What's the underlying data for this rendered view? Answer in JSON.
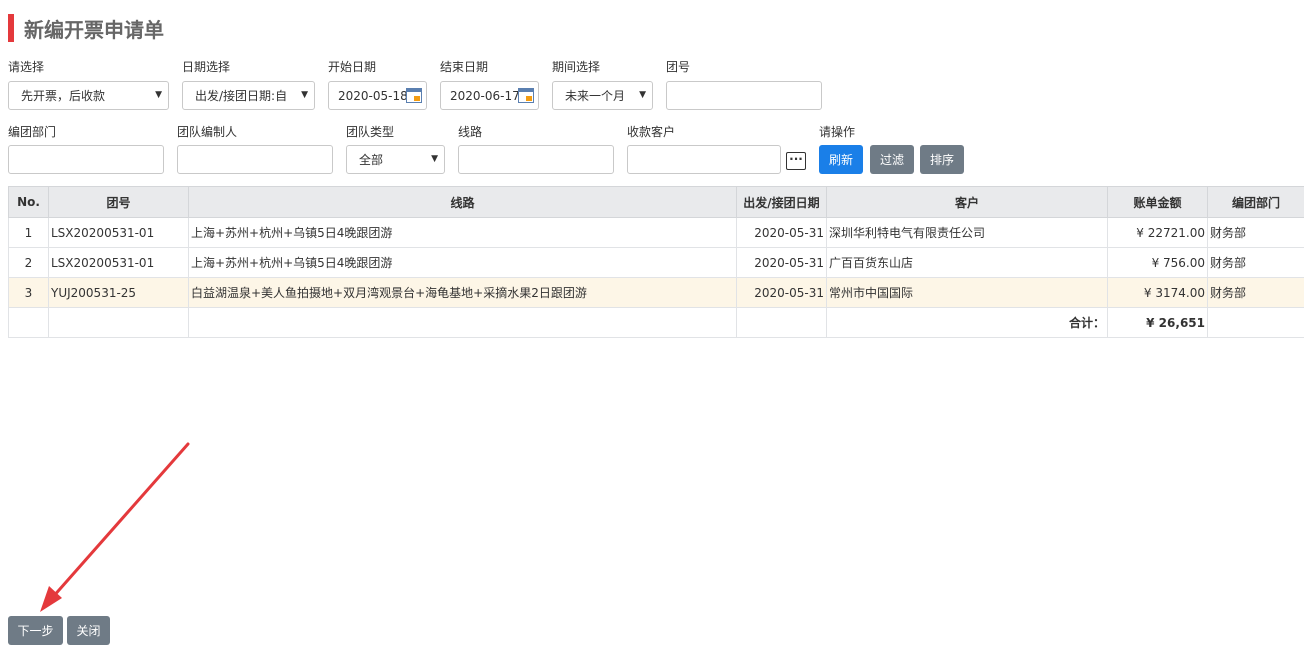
{
  "page": {
    "title": "新编开票申请单"
  },
  "filters": {
    "select_label": "请选择",
    "select_value": "先开票，后收款",
    "date_select_label": "日期选择",
    "date_select_value": "出发/接团日期:自",
    "start_date_label": "开始日期",
    "start_date_value": "2020-05-18",
    "end_date_label": "结束日期",
    "end_date_value": "2020-06-17",
    "period_label": "期间选择",
    "period_value": "未来一个月",
    "group_no_label": "团号",
    "group_no_value": "",
    "dept_label": "编团部门",
    "dept_value": "",
    "maker_label": "团队编制人",
    "maker_value": "",
    "type_label": "团队类型",
    "type_value": "全部",
    "route_label": "线路",
    "route_value": "",
    "customer_label": "收款客户",
    "customer_value": "",
    "more_icon": "ellipsis-icon",
    "ops_label": "请操作",
    "refresh": "刷新",
    "filter": "过滤",
    "sort": "排序"
  },
  "table": {
    "headers": [
      "No.",
      "团号",
      "线路",
      "出发/接团日期",
      "客户",
      "账单金额",
      "编团部门"
    ],
    "rows": [
      {
        "no": "1",
        "group": "LSX20200531-01",
        "route": "上海+苏州+杭州+乌镇5日4晚跟团游",
        "date": "2020-05-31",
        "customer": "深圳华利特电气有限责任公司",
        "amount": "¥ 22721.00",
        "dept": "财务部"
      },
      {
        "no": "2",
        "group": "LSX20200531-01",
        "route": "上海+苏州+杭州+乌镇5日4晚跟团游",
        "date": "2020-05-31",
        "customer": "广百百货东山店",
        "amount": "¥ 756.00",
        "dept": "财务部"
      },
      {
        "no": "3",
        "group": "YUJ200531-25",
        "route": "白益湖温泉+美人鱼拍摄地+双月湾观景台+海龟基地+采摘水果2日跟团游",
        "date": "2020-05-31",
        "customer": "常州市中国国际",
        "amount": "¥ 3174.00",
        "dept": "财务部"
      }
    ],
    "total_label": "合计：",
    "total_value": "¥ 26,651"
  },
  "footer": {
    "next": "下一步",
    "close": "关闭"
  },
  "colors": {
    "accent": "#e4393c",
    "primary": "#1a7fe8",
    "secondary": "#6f7b86",
    "annotation": "#e4393c"
  }
}
